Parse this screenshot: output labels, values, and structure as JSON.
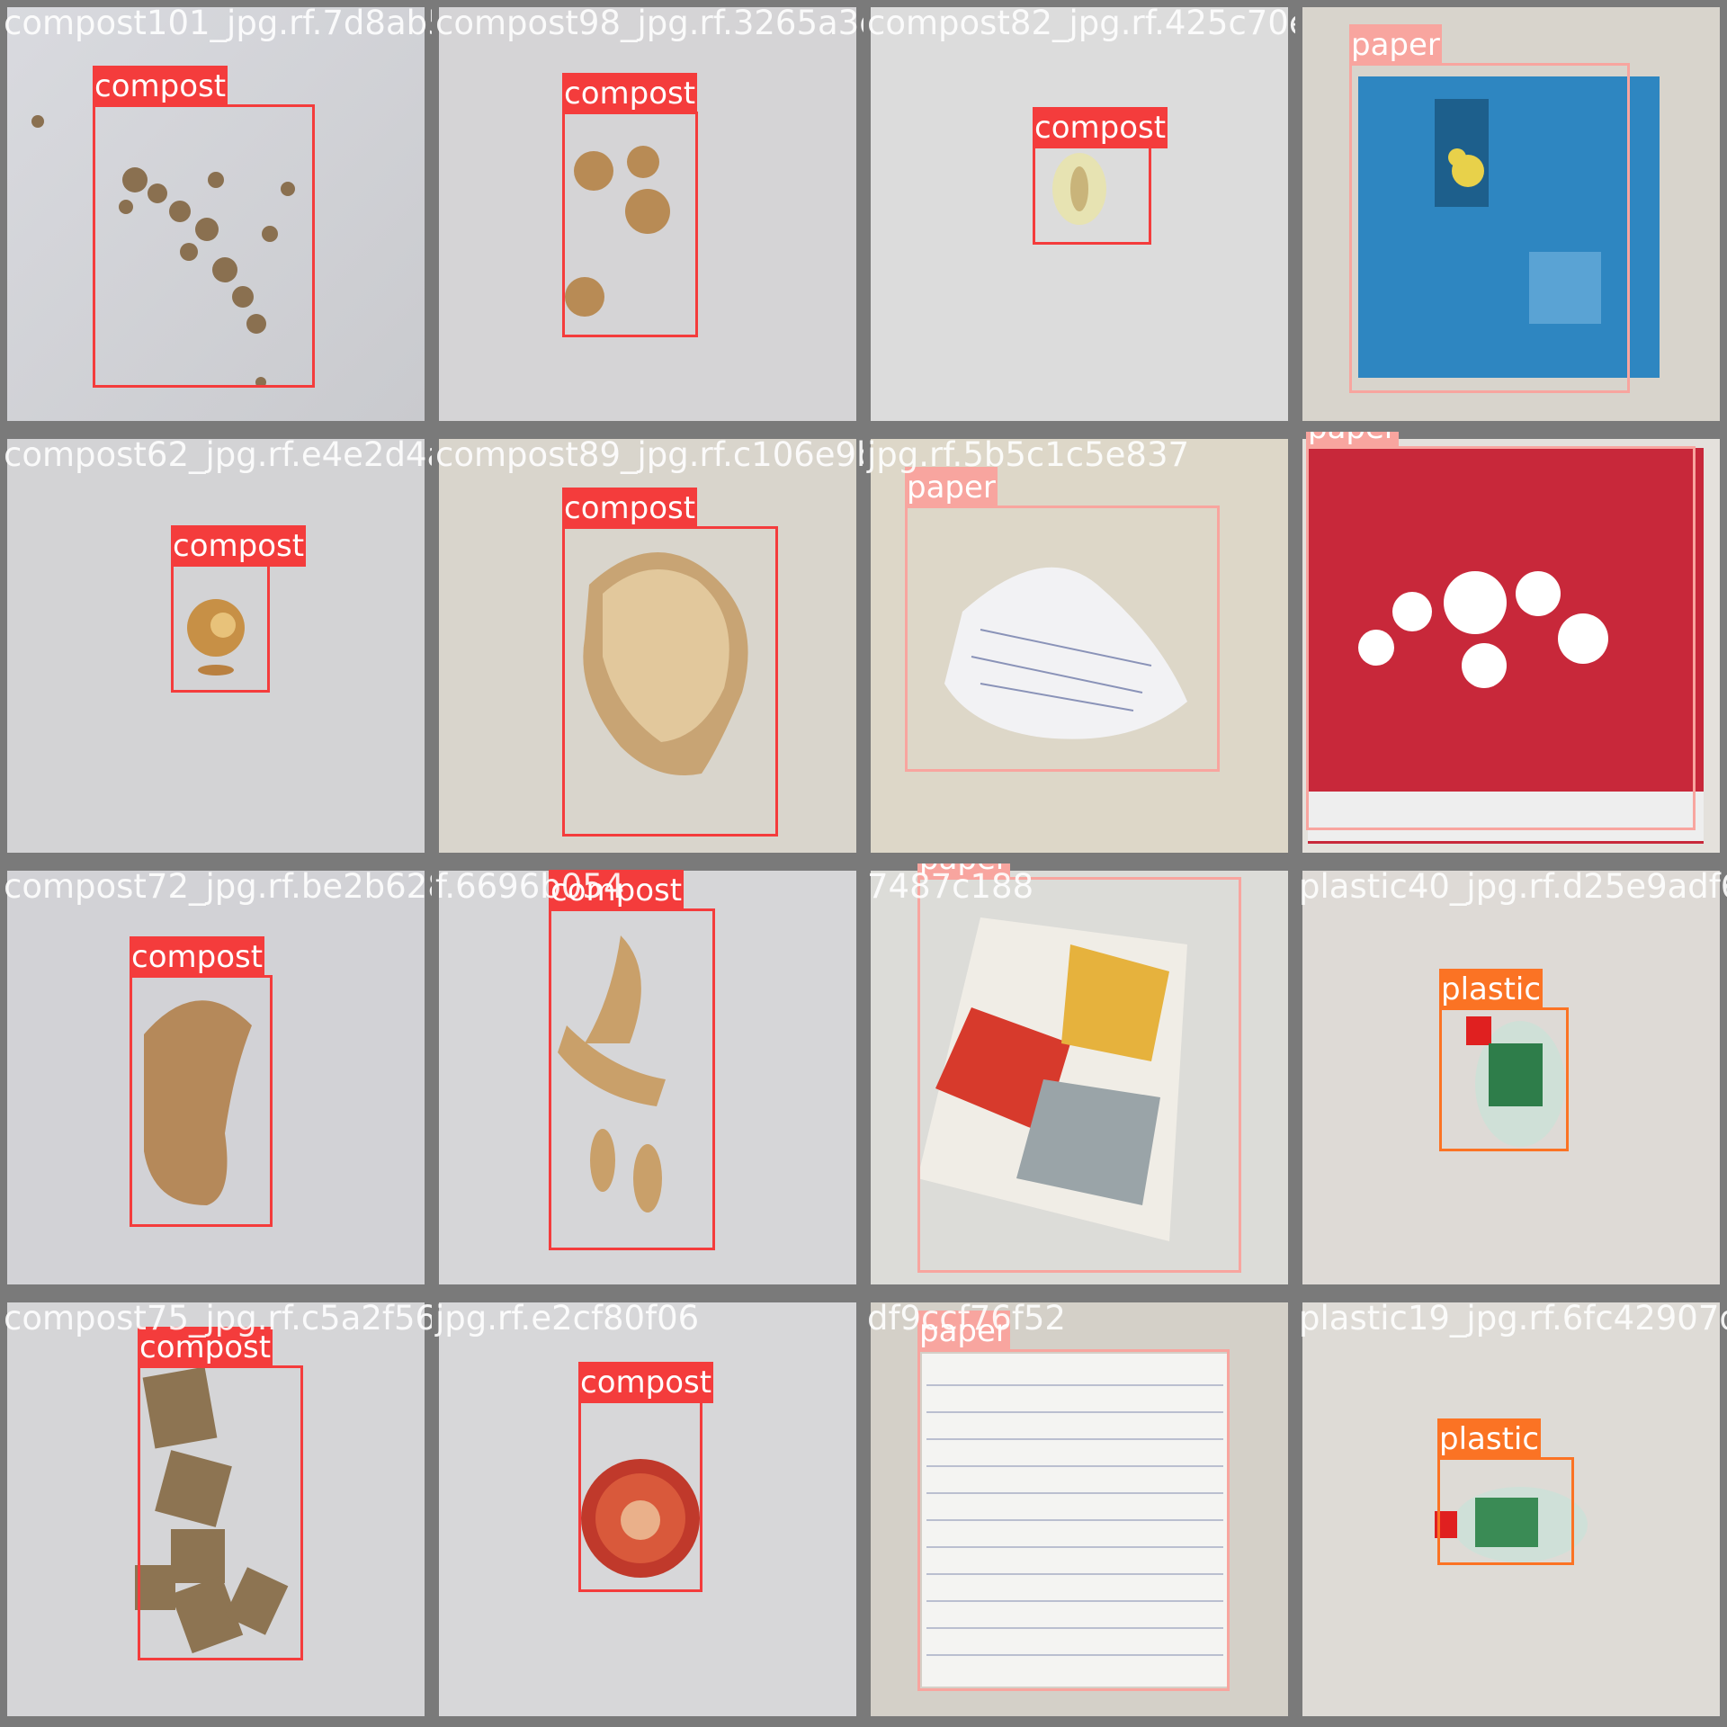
{
  "colors": {
    "compost": "#f43c3c",
    "paper": "#f8a59f",
    "plastic": "#fb7324",
    "frame": "#7a7a7a"
  },
  "tiles": [
    {
      "filename": "compost101_jpg.rf.7d8ab5e",
      "objects": [
        {
          "label": "compost",
          "class": "compost"
        }
      ]
    },
    {
      "filename": "compost98_jpg.rf.3265a3d512a87",
      "objects": [
        {
          "label": "compost",
          "class": "compost"
        }
      ]
    },
    {
      "filename": "compost82_jpg.rf.425c70ea5bb",
      "objects": [
        {
          "label": "compost",
          "class": "compost"
        }
      ]
    },
    {
      "filename": "",
      "objects": [
        {
          "label": "paper",
          "class": "paper"
        }
      ]
    },
    {
      "filename": "compost62_jpg.rf.e4e2d4ae",
      "objects": [
        {
          "label": "compost",
          "class": "compost"
        }
      ]
    },
    {
      "filename": "compost89_jpg.rf.c106e9b38",
      "objects": [
        {
          "label": "compost",
          "class": "compost"
        }
      ]
    },
    {
      "filename": "jpg.rf.5b5c1c5e837",
      "objects": [
        {
          "label": "paper",
          "class": "paper"
        }
      ]
    },
    {
      "filename": "",
      "objects": [
        {
          "label": "paper",
          "class": "paper"
        }
      ]
    },
    {
      "filename": "compost72_jpg.rf.be2b6285",
      "objects": [
        {
          "label": "compost",
          "class": "compost"
        }
      ]
    },
    {
      "filename": "f.6696b054",
      "objects": [
        {
          "label": "compost",
          "class": "compost"
        }
      ]
    },
    {
      "filename": "7487c188",
      "objects": [
        {
          "label": "paper",
          "class": "paper"
        }
      ]
    },
    {
      "filename": "plastic40_jpg.rf.d25e9adf6cc",
      "objects": [
        {
          "label": "plastic",
          "class": "plastic"
        }
      ]
    },
    {
      "filename": "compost75_jpg.rf.c5a2f5611",
      "objects": [
        {
          "label": "compost",
          "class": "compost"
        }
      ]
    },
    {
      "filename": "jpg.rf.e2cf80f06",
      "objects": [
        {
          "label": "compost",
          "class": "compost"
        }
      ]
    },
    {
      "filename": "df9ccf76f52",
      "objects": [
        {
          "label": "paper",
          "class": "paper"
        }
      ]
    },
    {
      "filename": "plastic19_jpg.rf.6fc42907df0",
      "objects": [
        {
          "label": "plastic",
          "class": "plastic"
        }
      ]
    }
  ]
}
